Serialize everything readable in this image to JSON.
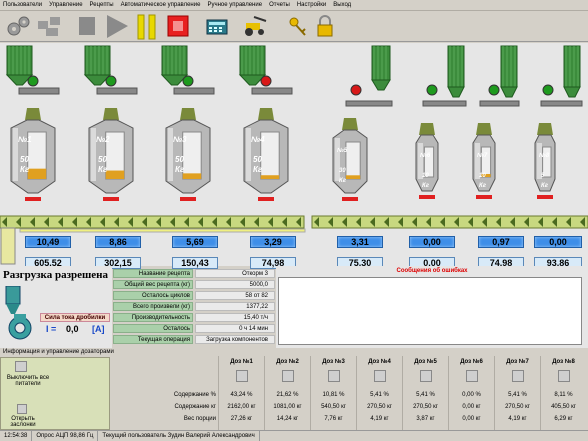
{
  "menu": [
    "Пользователи",
    "Управление",
    "Рецепты",
    "Автоматическое управление",
    "Ручное управление",
    "Отчеты",
    "Настройки",
    "Выход"
  ],
  "hoppers": [
    {
      "name": "№1",
      "capacity": "50",
      "unit": "Кг",
      "weight": "10,49",
      "total": "605,52",
      "light": "green",
      "fill": 0.22
    },
    {
      "name": "№2",
      "capacity": "50",
      "unit": "Кг",
      "weight": "8,86",
      "total": "302,15",
      "light": "green",
      "fill": 0.18
    },
    {
      "name": "№3",
      "capacity": "50",
      "unit": "Кг",
      "weight": "5,69",
      "total": "150,43",
      "light": "green",
      "fill": 0.12
    },
    {
      "name": "№4",
      "capacity": "50",
      "unit": "Кг",
      "weight": "3,29",
      "total": "74,98",
      "light": "red",
      "fill": 0.08
    },
    {
      "name": "№5",
      "capacity": "30",
      "unit": "Кг",
      "weight": "3,31",
      "total": "75,30",
      "light": "red",
      "fill": 0.1
    },
    {
      "name": "№6",
      "capacity": "10",
      "unit": "Кг",
      "weight": "0,00",
      "total": "0,00",
      "light": "green",
      "fill": 0
    },
    {
      "name": "№7",
      "capacity": "10",
      "unit": "Кг",
      "weight": "0,97",
      "total": "74,98",
      "light": "green",
      "fill": 0.1
    },
    {
      "name": "№8",
      "capacity": "5",
      "unit": "Кг",
      "weight": "0,00",
      "total": "93,86",
      "light": "green",
      "fill": 0
    }
  ],
  "unload": {
    "title": "Разгрузка разрешена",
    "crusher_label": "Сила тока дробилки",
    "i_label": "I =",
    "i_value": "0,0",
    "i_unit": "[A]"
  },
  "recipe": {
    "rows": [
      {
        "k": "Название рецепта",
        "v": "Откорм 3"
      },
      {
        "k": "Общий вес рецепта (кг)",
        "v": "5000,0"
      },
      {
        "k": "Осталось циклов",
        "v": "58 от 82"
      },
      {
        "k": "Всего произвели (кг)",
        "v": "1377,22"
      },
      {
        "k": "Производительность",
        "v": "15,40 т/ч"
      },
      {
        "k": "Осталось",
        "v": "0 ч 14 мин"
      },
      {
        "k": "Текущая операция",
        "v": "Загрузка компонентов"
      }
    ]
  },
  "errors": {
    "title": "Сообщения об ошибках"
  },
  "lower": {
    "title": "Информация и управление дозаторами",
    "btn1": "Выключить все питатели",
    "btn2": "Открыть заслонки",
    "row_labels": [
      "Содержание %",
      "Содержание кг",
      "Вес порции"
    ]
  },
  "dosers": [
    {
      "name": "Доз №1",
      "pct": "43,24 %",
      "kg": "2162,00 кг",
      "portion": "27,26 кг"
    },
    {
      "name": "Доз №2",
      "pct": "21,62 %",
      "kg": "1081,00 кг",
      "portion": "14,24 кг"
    },
    {
      "name": "Доз №3",
      "pct": "10,81 %",
      "kg": "540,50 кг",
      "portion": "7,76 кг"
    },
    {
      "name": "Доз №4",
      "pct": "5,41 %",
      "kg": "270,50 кг",
      "portion": "4,19 кг"
    },
    {
      "name": "Доз №5",
      "pct": "5,41 %",
      "kg": "270,50 кг",
      "portion": "3,87 кг"
    },
    {
      "name": "Доз №6",
      "pct": "0,00 %",
      "kg": "0,00 кг",
      "portion": "0,00 кг"
    },
    {
      "name": "Доз №7",
      "pct": "5,41 %",
      "kg": "270,50 кг",
      "portion": "4,19 кг"
    },
    {
      "name": "Доз №8",
      "pct": "8,11 %",
      "kg": "405,50 кг",
      "portion": "6,29 кг"
    }
  ],
  "status": {
    "time": "12:54:38",
    "adc": "Опрос АЦП 98,86 Гц",
    "user": "Текущий пользователь  Зудин Валерий Александрович"
  },
  "colors": {
    "silo": "#3c8c3c",
    "hopper": "#b8b8b8",
    "fill": "#e0a020",
    "conveyor": "#c8d880",
    "ok": "#1e9a1e",
    "stop": "#d81818"
  }
}
